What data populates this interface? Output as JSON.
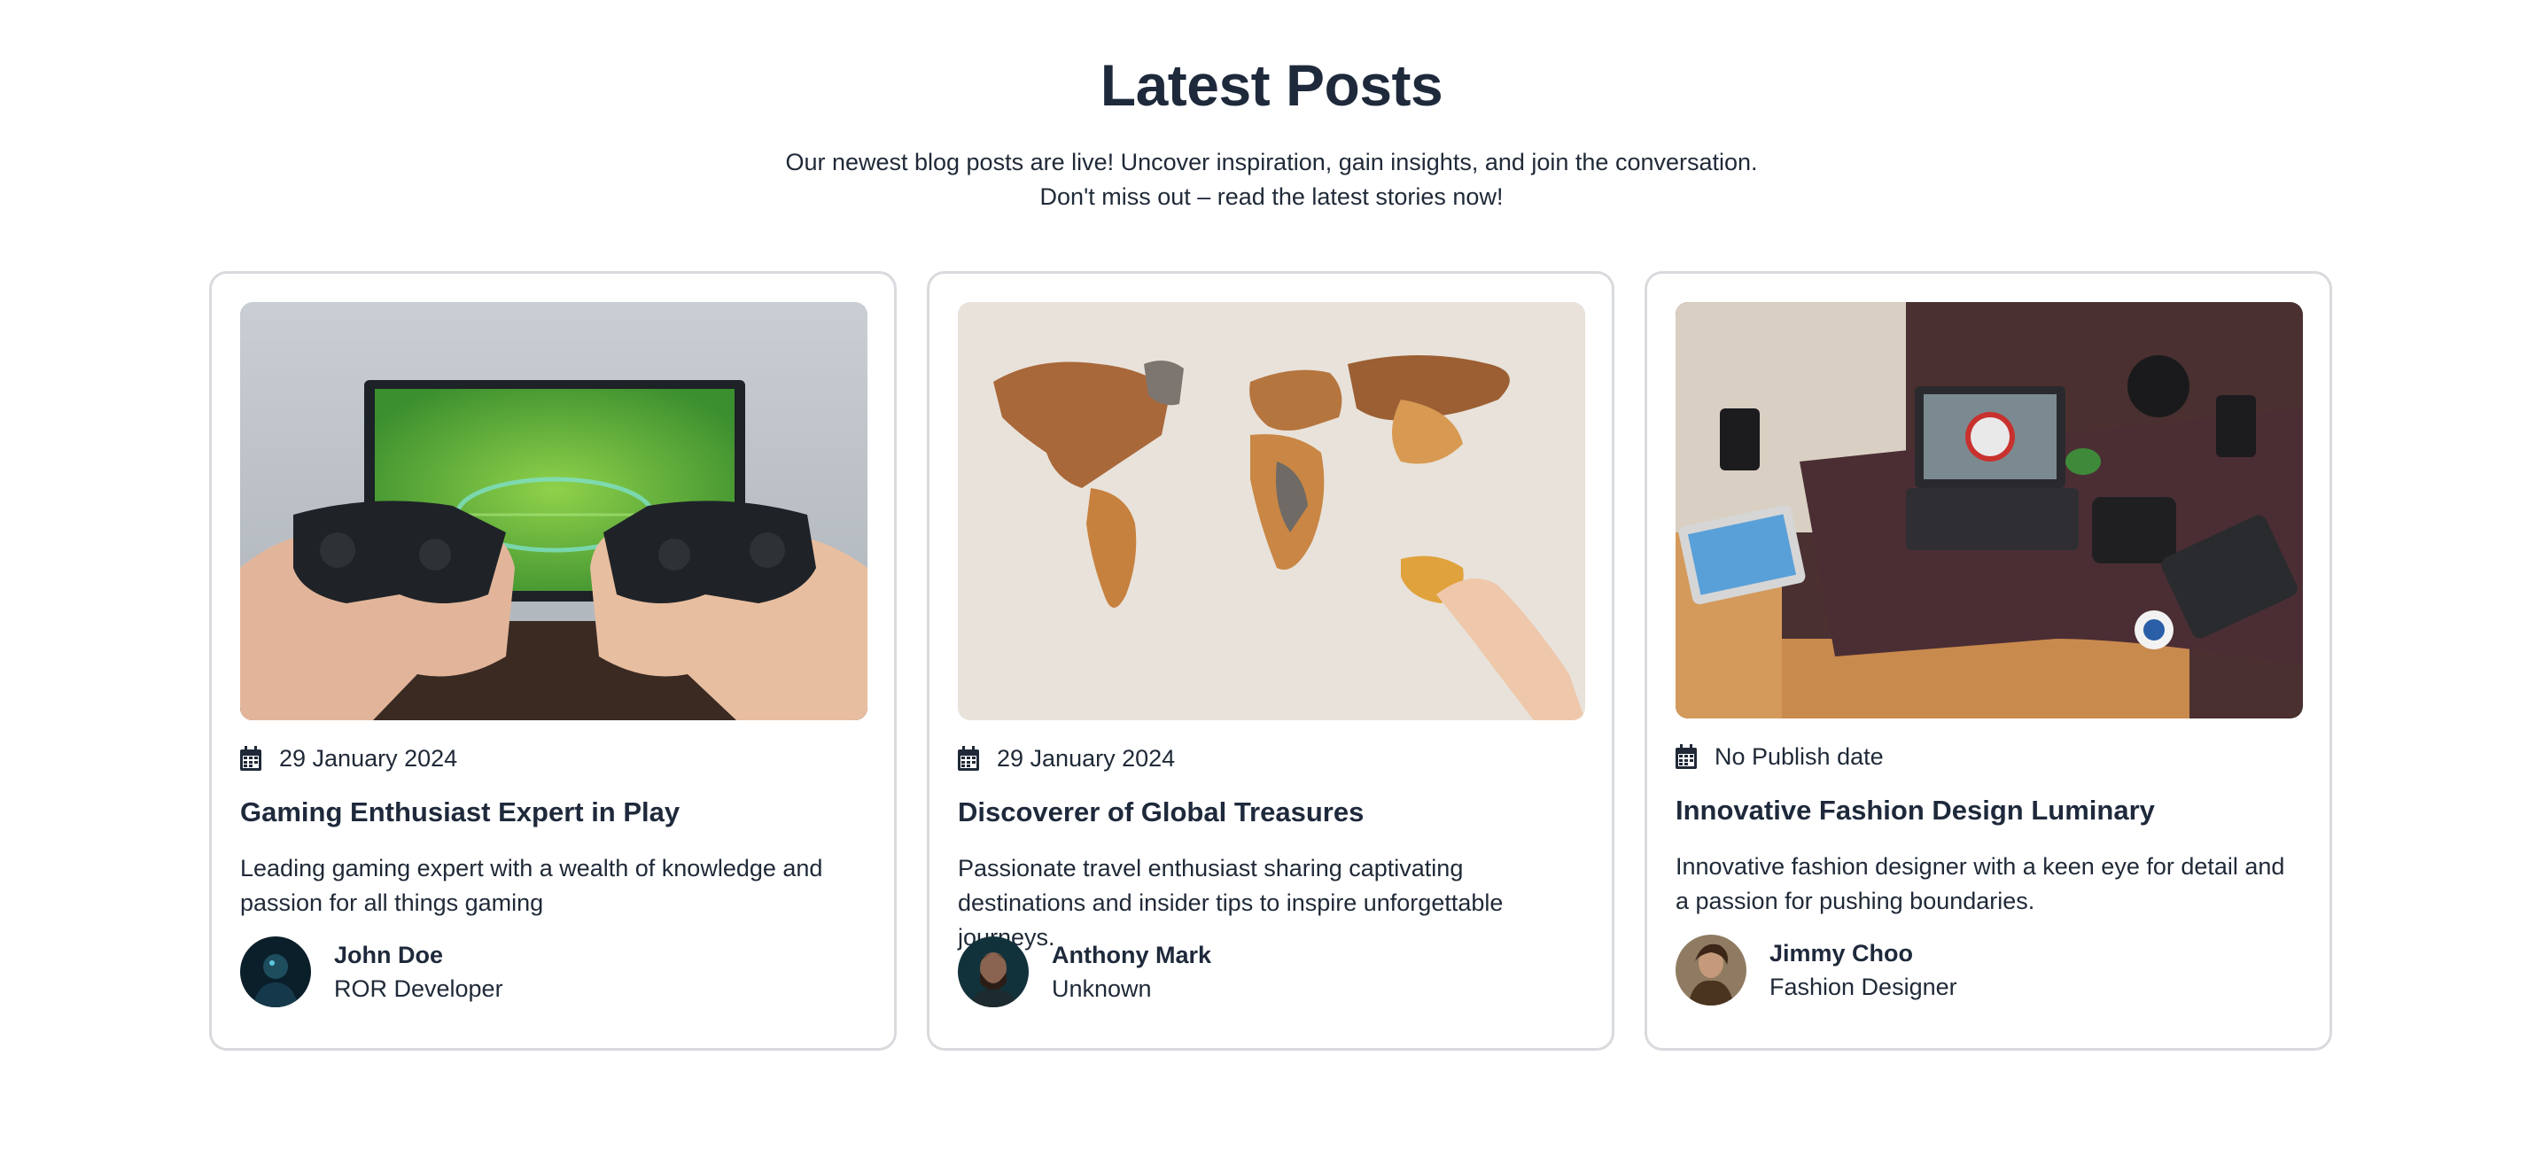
{
  "section": {
    "title": "Latest Posts",
    "subtitle_line1": "Our newest blog posts are live! Uncover inspiration, gain insights, and join the conversation.",
    "subtitle_line2": "Don't miss out – read the latest stories now!"
  },
  "posts": [
    {
      "image": "gaming-controllers-photo",
      "date": "29 January 2024",
      "title": "Gaming Enthusiast Expert in Play",
      "description": "Leading gaming expert with a wealth of knowledge and passion for all things gaming",
      "author": {
        "name": "John Doe",
        "role": "ROR Developer"
      }
    },
    {
      "image": "world-map-wall-photo",
      "date": "29 January 2024",
      "title": "Discoverer of Global Treasures",
      "description": "Passionate travel enthusiast sharing captivating destinations and insider tips to inspire unforgettable journeys.",
      "author": {
        "name": "Anthony Mark",
        "role": "Unknown"
      }
    },
    {
      "image": "desk-workspace-photo",
      "date": "No Publish date",
      "title": "Innovative Fashion Design Luminary",
      "description": "Innovative fashion designer with a keen eye for detail and a passion for pushing boundaries.",
      "author": {
        "name": "Jimmy Choo",
        "role": "Fashion Designer"
      }
    }
  ],
  "icons": {
    "date": "calendar-icon"
  },
  "colors": {
    "text": "#1e293b",
    "border": "#d8dadd"
  }
}
